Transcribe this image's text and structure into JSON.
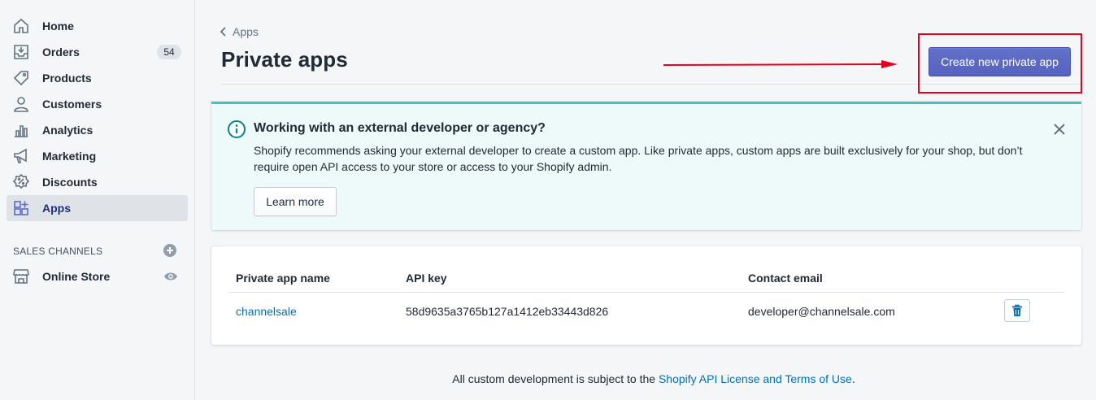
{
  "sidebar": {
    "items": [
      {
        "label": "Home",
        "icon": "home-icon"
      },
      {
        "label": "Orders",
        "icon": "orders-icon",
        "badge": "54"
      },
      {
        "label": "Products",
        "icon": "tag-icon"
      },
      {
        "label": "Customers",
        "icon": "person-icon"
      },
      {
        "label": "Analytics",
        "icon": "bar-chart-icon"
      },
      {
        "label": "Marketing",
        "icon": "megaphone-icon"
      },
      {
        "label": "Discounts",
        "icon": "discount-icon"
      },
      {
        "label": "Apps",
        "icon": "apps-icon",
        "active": true
      }
    ],
    "sales_channels": {
      "title": "SALES CHANNELS",
      "items": [
        {
          "label": "Online Store",
          "icon": "store-icon"
        }
      ]
    }
  },
  "header": {
    "breadcrumb": "Apps",
    "title": "Private apps",
    "primary_action": "Create new private app"
  },
  "banner": {
    "title": "Working with an external developer or agency?",
    "text": "Shopify recommends asking your external developer to create a custom app. Like private apps, custom apps are built exclusively for your shop, but don’t require open API access to your store or access to your Shopify admin.",
    "action": "Learn more"
  },
  "table": {
    "columns": [
      "Private app name",
      "API key",
      "Contact email"
    ],
    "rows": [
      {
        "name": "channelsale",
        "api_key": "58d9635a3765b127a1412eb33443d826",
        "email": "developer@channelsale.com"
      }
    ]
  },
  "footer": {
    "text_before": "All custom development is subject to the ",
    "link": "Shopify API License and Terms of Use",
    "text_after": "."
  },
  "colors": {
    "primary": "#5c6ac4",
    "link": "#006fbb",
    "banner_accent": "#47c1bf",
    "annotation_red": "#e6001f"
  }
}
